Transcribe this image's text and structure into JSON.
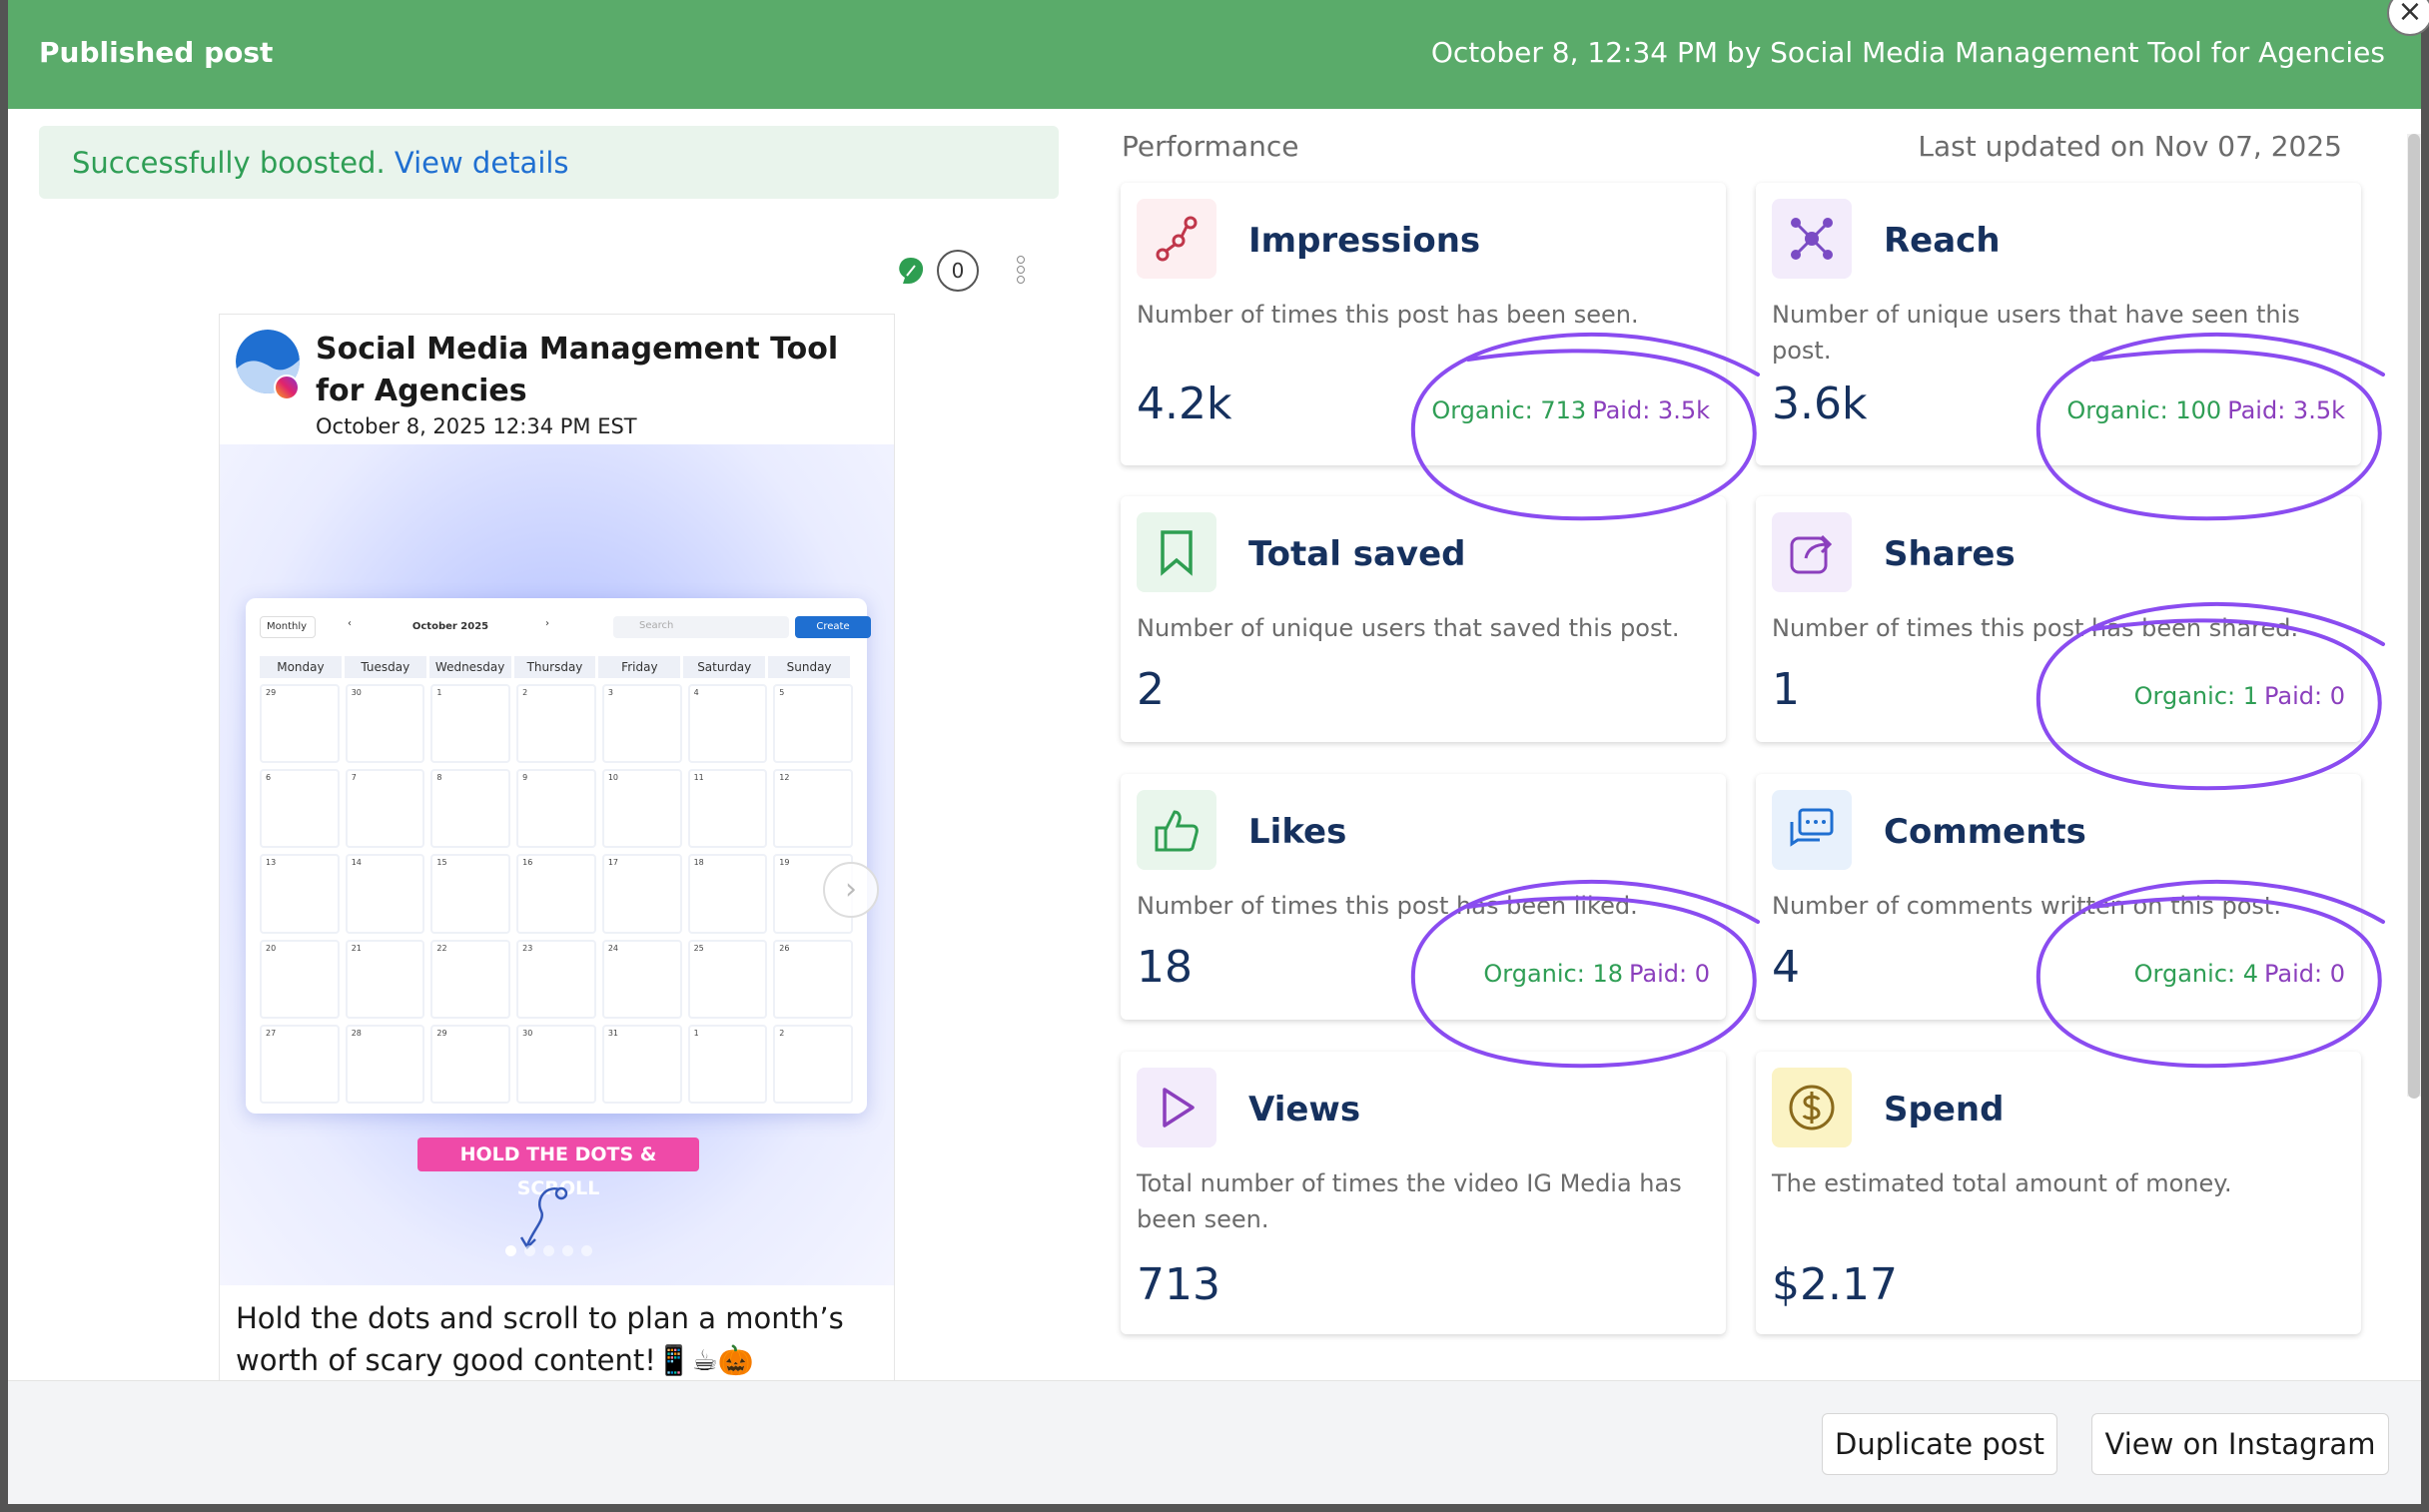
{
  "modal": {
    "title": "Published post",
    "meta": "October 8, 12:34 PM by Social Media Management Tool for Agencies",
    "close_label": "×"
  },
  "boost": {
    "status": "Successfully boosted.",
    "link": "View details"
  },
  "post_tools": {
    "comment_count": "0"
  },
  "post": {
    "author": "Social Media Management Tool for Agencies",
    "date": "October 8, 2025 12:34 PM EST",
    "caption": "Hold the dots and scroll to plan a month’s worth of scary good content!📱☕🎃",
    "image": {
      "calendar_view": "Monthly",
      "calendar_month": "October 2025",
      "search_placeholder": "Search",
      "create_label": "Create",
      "weekdays": [
        "Monday",
        "Tuesday",
        "Wednesday",
        "Thursday",
        "Friday",
        "Saturday",
        "Sunday"
      ],
      "dates": [
        "29",
        "30",
        "1",
        "2",
        "3",
        "4",
        "5",
        "6",
        "7",
        "8",
        "9",
        "10",
        "11",
        "12",
        "13",
        "14",
        "15",
        "16",
        "17",
        "18",
        "19",
        "20",
        "21",
        "22",
        "23",
        "24",
        "25",
        "26",
        "27",
        "28",
        "29",
        "30",
        "31",
        "1",
        "2"
      ],
      "tag": "HOLD THE DOTS & SCROLL",
      "carousel_total": 5,
      "carousel_active": 1
    }
  },
  "performance": {
    "title": "Performance",
    "updated": "Last updated on Nov 07, 2025",
    "metrics": [
      {
        "key": "impressions",
        "title": "Impressions",
        "desc": "Number of times this post has been seen.",
        "value": "4.2k",
        "organic": "Organic: 713",
        "paid": "Paid: 3.5k",
        "icon": "share-nodes-icon",
        "accent": "#c0364a",
        "bg": "#fdeff1"
      },
      {
        "key": "reach",
        "title": "Reach",
        "desc": "Number of unique users that have seen this post.",
        "value": "3.6k",
        "organic": "Organic: 100",
        "paid": "Paid: 3.5k",
        "icon": "network-icon",
        "accent": "#7a4bc4",
        "bg": "#f3ecfb"
      },
      {
        "key": "saved",
        "title": "Total saved",
        "desc": "Number of unique users that saved this post.",
        "value": "2",
        "icon": "bookmark-icon",
        "accent": "#2e9e51",
        "bg": "#e9f6ec"
      },
      {
        "key": "shares",
        "title": "Shares",
        "desc": "Number of times this post has been shared.",
        "value": "1",
        "organic": "Organic: 1",
        "paid": "Paid: 0",
        "icon": "share-arrow-icon",
        "accent": "#8b3fbd",
        "bg": "#f3ecfb"
      },
      {
        "key": "likes",
        "title": "Likes",
        "desc": "Number of times this post has been liked.",
        "value": "18",
        "organic": "Organic: 18",
        "paid": "Paid: 0",
        "icon": "thumbs-up-icon",
        "accent": "#2e9e51",
        "bg": "#e9f6ec"
      },
      {
        "key": "comments",
        "title": "Comments",
        "desc": "Number of comments written on this post.",
        "value": "4",
        "organic": "Organic: 4",
        "paid": "Paid: 0",
        "icon": "comments-icon",
        "accent": "#1f6fd1",
        "bg": "#e8f1fc"
      },
      {
        "key": "views",
        "title": "Views",
        "desc": "Total number of times the video IG Media has been seen.",
        "value": "713",
        "icon": "play-icon",
        "accent": "#8b3fbd",
        "bg": "#f3ecfb"
      },
      {
        "key": "spend",
        "title": "Spend",
        "desc": "The estimated total amount of money.",
        "value": "$2.17",
        "icon": "dollar-icon",
        "accent": "#8a6a1c",
        "bg": "#fbf3c4"
      }
    ]
  },
  "footer": {
    "duplicate": "Duplicate post",
    "view_instagram": "View on Instagram"
  },
  "annotation_color": "#8a4cf0"
}
